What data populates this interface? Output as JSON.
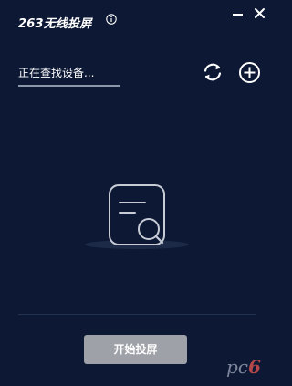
{
  "app": {
    "title": "263无线投屏"
  },
  "icons": {
    "info": "info-circle-icon",
    "minimize": "minimize-icon",
    "close": "close-icon",
    "refresh": "refresh-icon",
    "add": "add-circle-icon",
    "empty": "document-search-icon"
  },
  "search": {
    "status_text": "正在查找设备..."
  },
  "footer": {
    "start_label": "开始投屏"
  },
  "watermark": {
    "text_pc": "pc",
    "text_six": "6"
  },
  "colors": {
    "background": "#0c1834",
    "button_disabled": "#9ea1a8",
    "divider": "#233151",
    "progress_line": "#8c96ab"
  }
}
